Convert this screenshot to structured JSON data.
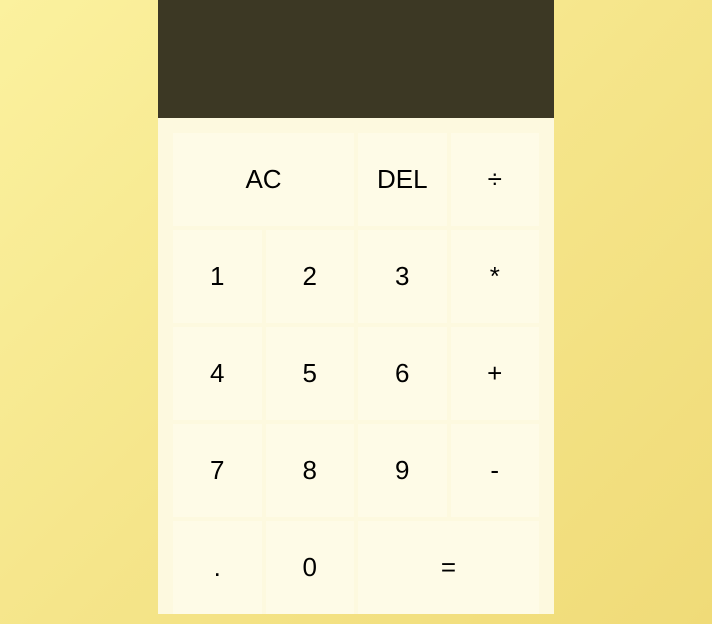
{
  "display": {
    "value": ""
  },
  "buttons": {
    "ac": "AC",
    "del": "DEL",
    "divide": "÷",
    "one": "1",
    "two": "2",
    "three": "3",
    "multiply": "*",
    "four": "4",
    "five": "5",
    "six": "6",
    "plus": "+",
    "seven": "7",
    "eight": "8",
    "nine": "9",
    "minus": "-",
    "dot": ".",
    "zero": "0",
    "equals": "="
  }
}
